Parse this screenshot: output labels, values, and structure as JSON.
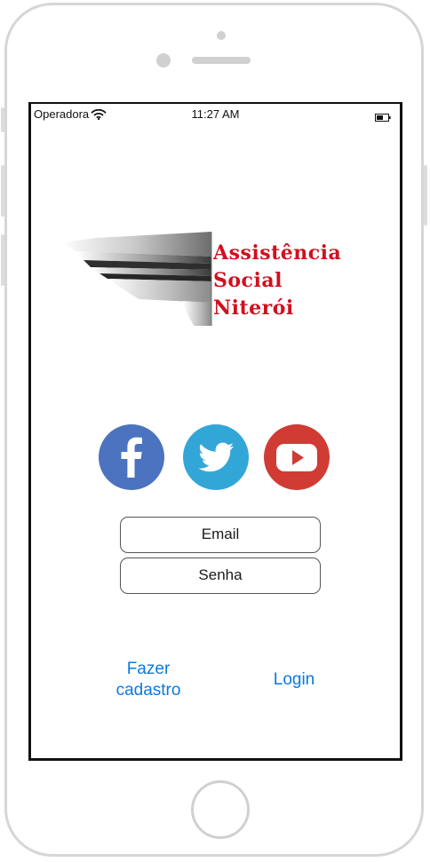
{
  "status_bar": {
    "carrier": "Operadora",
    "time": "11:27 AM",
    "wifi_icon": "wifi-icon",
    "battery_icon": "battery-icon"
  },
  "logo": {
    "line1": "Assistência",
    "line2": "Social",
    "line3": "Niterói",
    "text_color": "#d0101f"
  },
  "social": [
    {
      "name": "facebook",
      "icon": "facebook-icon",
      "color": "#4b73bf"
    },
    {
      "name": "twitter",
      "icon": "twitter-icon",
      "color": "#33a6d8"
    },
    {
      "name": "youtube",
      "icon": "youtube-icon",
      "color": "#d03b33"
    }
  ],
  "form": {
    "email_placeholder": "Email",
    "password_placeholder": "Senha"
  },
  "links": {
    "signup_line1": "Fazer",
    "signup_line2": "cadastro",
    "login": "Login",
    "link_color": "#0a7ae0"
  }
}
